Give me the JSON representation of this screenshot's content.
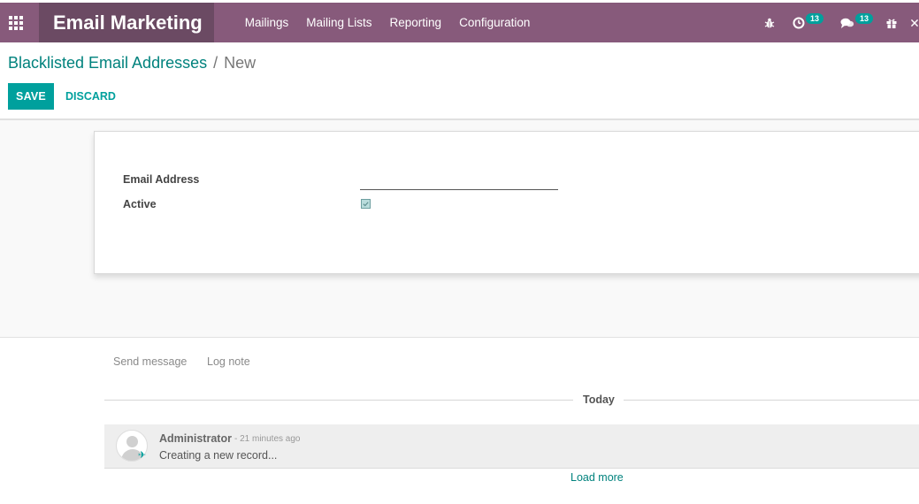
{
  "navbar": {
    "brand": "Email Marketing",
    "menu": [
      "Mailings",
      "Mailing Lists",
      "Reporting",
      "Configuration"
    ],
    "activity_count": "13",
    "messages_count": "13",
    "bg_color": "#875a7b"
  },
  "breadcrumb": {
    "parent": "Blacklisted Email Addresses",
    "separator": "/",
    "current": "New"
  },
  "buttons": {
    "save": "SAVE",
    "discard": "DISCARD"
  },
  "form": {
    "email_label": "Email Address",
    "email_value": "",
    "active_label": "Active",
    "active_checked": true
  },
  "chatter": {
    "send_message": "Send message",
    "log_note": "Log note",
    "today": "Today",
    "message": {
      "author": "Administrator",
      "date": "- 21 minutes ago",
      "body": "Creating a new record..."
    },
    "load_more": "Load more"
  }
}
